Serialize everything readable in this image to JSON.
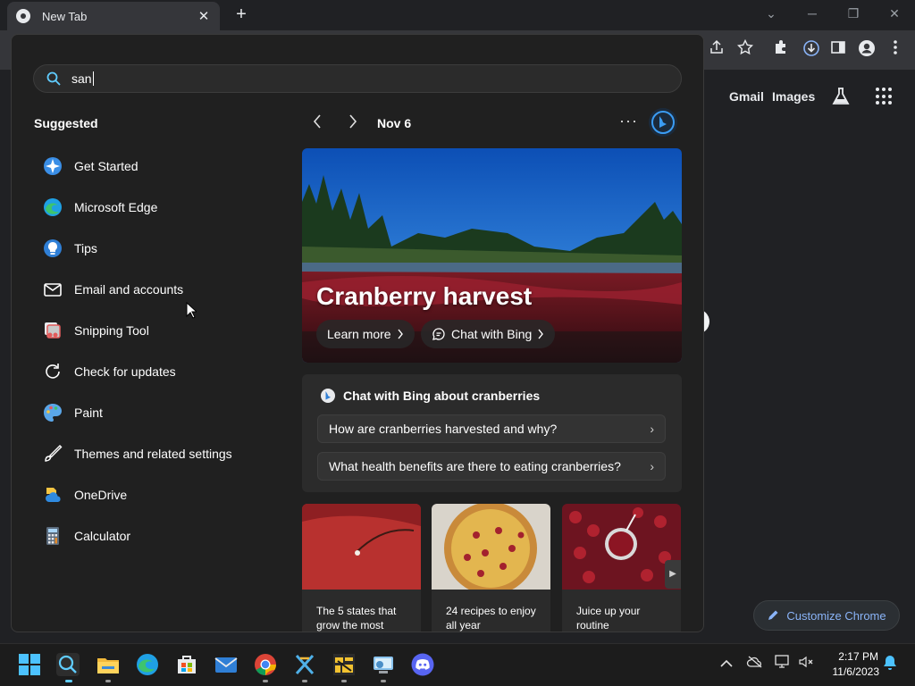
{
  "chrome": {
    "tab_title": "New Tab",
    "tab_close": "✕",
    "new_tab": "+",
    "window_controls": [
      "⌄",
      "─",
      "❐",
      "✕"
    ],
    "ntp_links": [
      "Gmail",
      "Images"
    ],
    "customize_label": "Customize Chrome"
  },
  "search": {
    "query": "san",
    "suggested_heading": "Suggested",
    "suggestions": [
      {
        "label": "Get Started",
        "icon": "get-started-icon"
      },
      {
        "label": "Microsoft Edge",
        "icon": "edge-icon"
      },
      {
        "label": "Tips",
        "icon": "tips-icon"
      },
      {
        "label": "Email and accounts",
        "icon": "mail-icon"
      },
      {
        "label": "Snipping Tool",
        "icon": "snipping-tool-icon"
      },
      {
        "label": "Check for updates",
        "icon": "refresh-icon"
      },
      {
        "label": "Paint",
        "icon": "paint-icon"
      },
      {
        "label": "Themes and related settings",
        "icon": "brush-icon"
      },
      {
        "label": "OneDrive",
        "icon": "onedrive-icon"
      },
      {
        "label": "Calculator",
        "icon": "calculator-icon"
      }
    ]
  },
  "highlight": {
    "date": "Nov 6",
    "more": "···",
    "hero_title": "Cranberry harvest",
    "learn_more": "Learn more",
    "chat_with_bing": "Chat with Bing",
    "chat_card_title": "Chat with Bing about cranberries",
    "questions": [
      "How are cranberries harvested and why?",
      "What health benefits are there to eating cranberries?"
    ],
    "stories": [
      "The 5 states that grow the most",
      "24 recipes to enjoy all year",
      "Juice up your routine"
    ]
  },
  "taskbar": {
    "time": "2:17 PM",
    "date": "11/6/2023",
    "apps": [
      "start-icon",
      "search-icon",
      "file-explorer-icon",
      "edge-icon",
      "store-icon",
      "mail-icon",
      "chrome-icon",
      "app-icon",
      "app-icon",
      "app-icon",
      "discord-icon"
    ]
  },
  "colors": {
    "accent": "#0078d4",
    "link_blue": "#8ab4f8",
    "panel": "#202020"
  }
}
